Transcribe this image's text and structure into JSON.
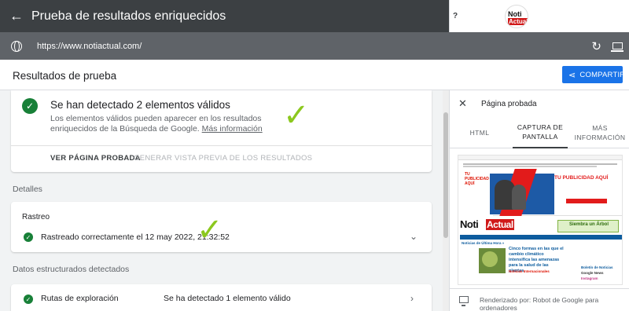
{
  "app": {
    "title": "Prueba de resultados enriquecidos",
    "help_icon": "?",
    "avatar_line1": "Noti",
    "avatar_line2": "Actual"
  },
  "urlbar": {
    "url": "https://www.notiactual.com/"
  },
  "results": {
    "title": "Resultados de prueba",
    "share_label": "COMPARTIR"
  },
  "summary": {
    "heading": "Se han detectado 2 elementos válidos",
    "description": "Los elementos válidos pueden aparecer en los resultados enriquecidos de la Búsqueda de Google.",
    "more_info": "Más información",
    "view_page_label": "VER PÁGINA PROBADA",
    "preview_label": "GENERAR VISTA PREVIA DE LOS RESULTADOS"
  },
  "details": {
    "section_label": "Detalles",
    "crawl_label": "Rastreo",
    "crawl_status": "Rastreado correctamente el 12 may 2022, 21:32:52"
  },
  "structured": {
    "section_label": "Datos estructurados detectados",
    "items": [
      {
        "name": "Rutas de exploración",
        "status": "Se ha detectado 1 elemento válido"
      }
    ]
  },
  "panel": {
    "title": "Página probada",
    "tabs": [
      {
        "label": "HTML"
      },
      {
        "label": "CAPTURA DE PANTALLA"
      },
      {
        "label": "MÁS INFORMACIÓN"
      }
    ],
    "footer": "Renderizado por: Robot de Google para ordenadores"
  },
  "site_preview": {
    "banner_title": "TU PUBLICIDAD AQUÍ",
    "banner_left": "TU PUBLICIDAD AQUÍ",
    "logo_a": "Noti",
    "logo_b": "Actual",
    "green_banner": "Siembra un Árbol",
    "article_title": "Cinco formas en las que el cambio climático intensifica las amenazas para la salud de las plantas",
    "section_news": "Noticias de Última Hora »",
    "section_intl": "Noticias Internacionales",
    "side_1": "Boletín de Noticias",
    "side_2": "Google News",
    "side_3": "Instagram"
  },
  "colors": {
    "topbar": "#3c4043",
    "urlbar": "#5f6368",
    "accent": "#1a73e8",
    "valid": "#188038",
    "annotation": "#8cc81e"
  }
}
